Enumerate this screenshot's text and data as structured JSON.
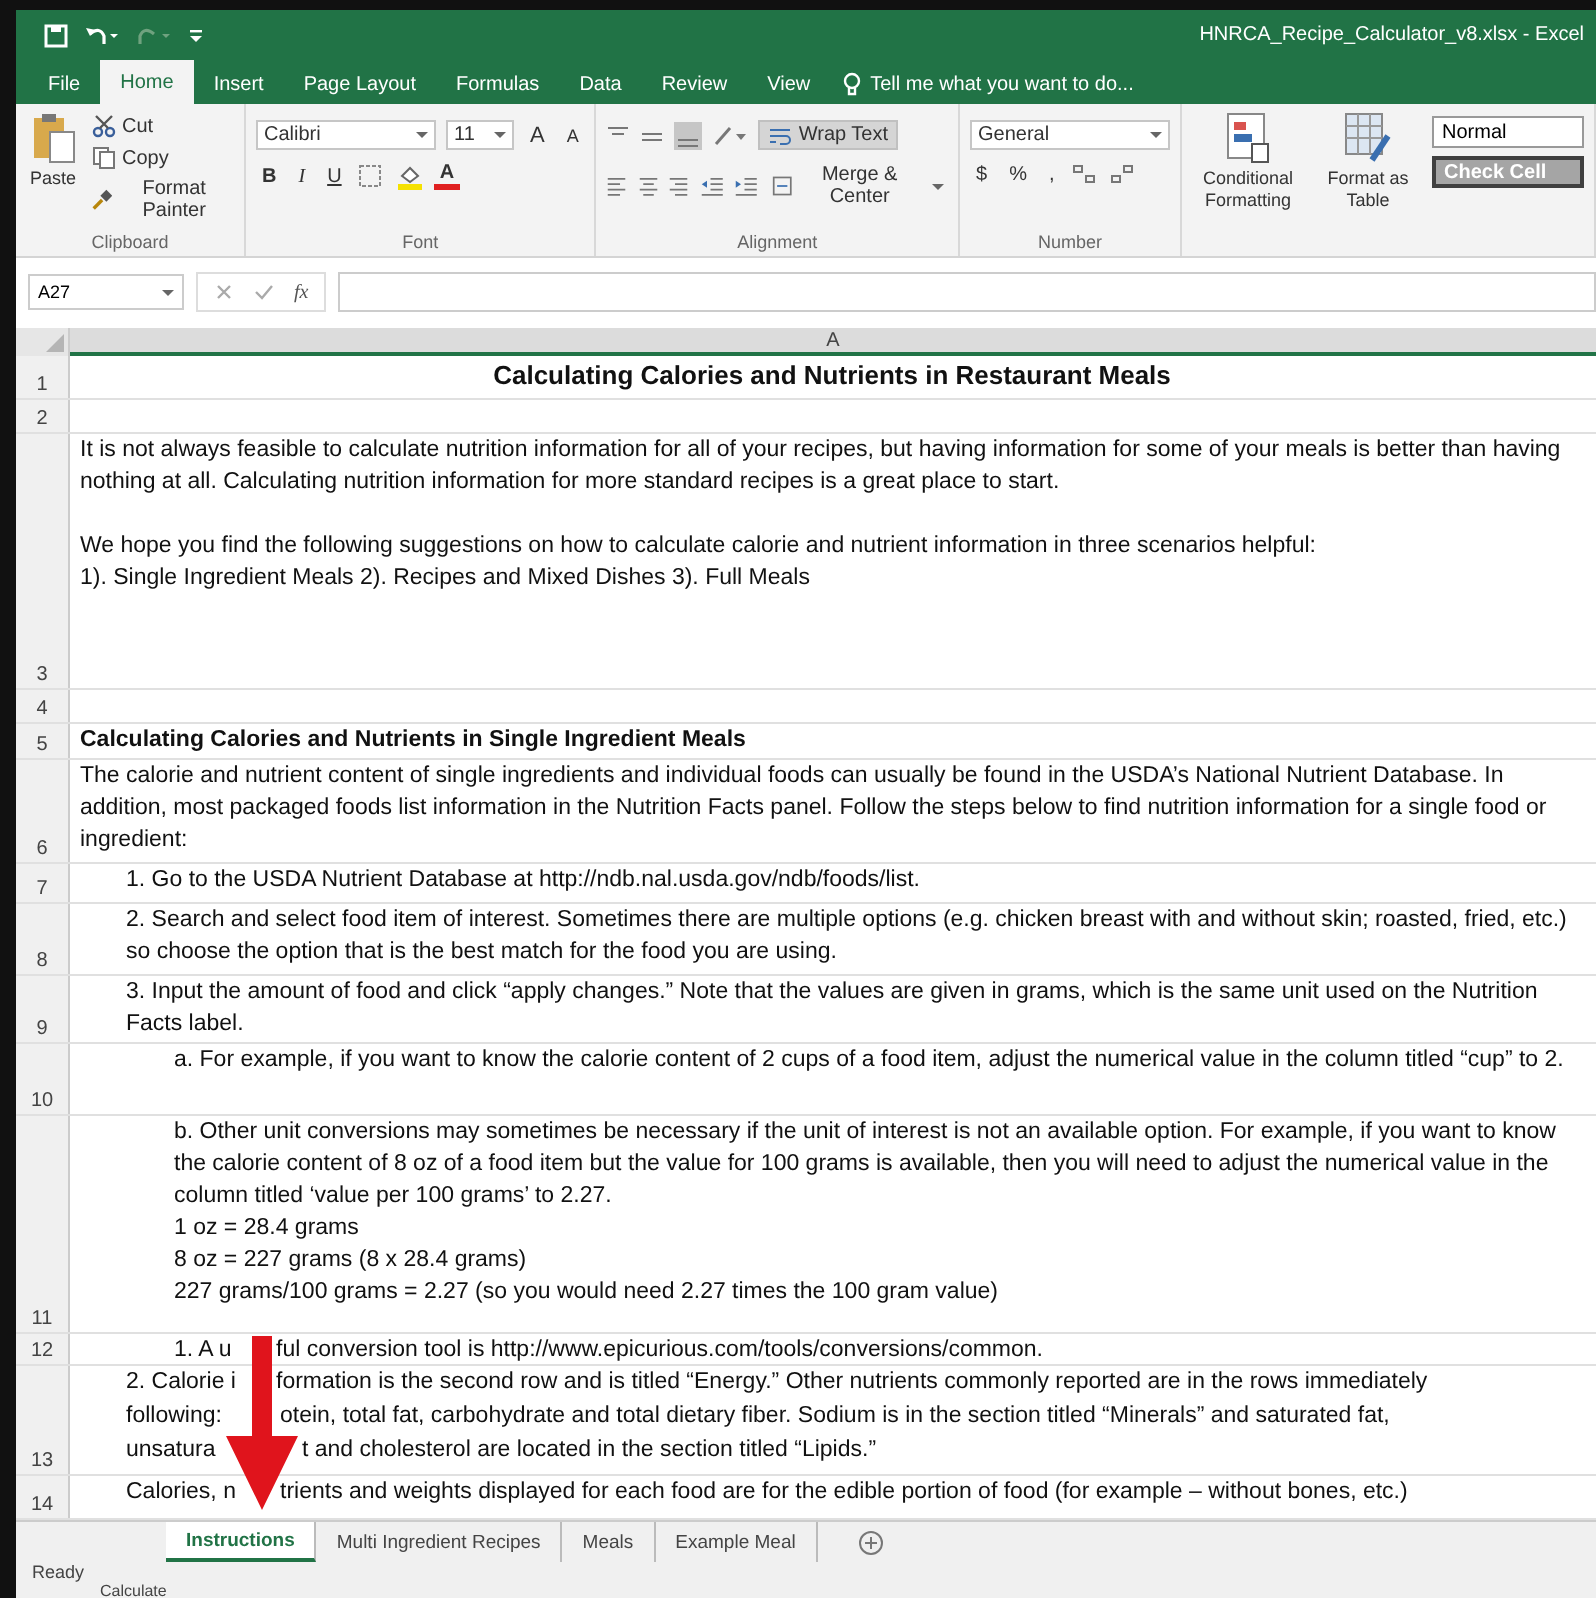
{
  "title_bar": {
    "title": "HNRCA_Recipe_Calculator_v8.xlsx - Excel"
  },
  "ribbon_tabs": [
    {
      "label": "File",
      "selected": false
    },
    {
      "label": "Home",
      "selected": true
    },
    {
      "label": "Insert",
      "selected": false
    },
    {
      "label": "Page Layout",
      "selected": false
    },
    {
      "label": "Formulas",
      "selected": false
    },
    {
      "label": "Data",
      "selected": false
    },
    {
      "label": "Review",
      "selected": false
    },
    {
      "label": "View",
      "selected": false
    }
  ],
  "tell_me": "Tell me what you want to do...",
  "clipboard": {
    "paste": "Paste",
    "cut": "Cut",
    "copy": "Copy",
    "format_painter": "Format Painter",
    "label": "Clipboard"
  },
  "font": {
    "name": "Calibri",
    "size": "11",
    "grow": "A",
    "shrink": "A",
    "bold": "B",
    "italic": "I",
    "underline": "U",
    "font_color_button": "A",
    "label": "Font"
  },
  "alignment": {
    "wrap_text": "Wrap Text",
    "merge_center": "Merge & Center",
    "label": "Alignment"
  },
  "number": {
    "format": "General",
    "currency": "$",
    "percent": "%",
    "comma": ",",
    "label": "Number"
  },
  "styles": {
    "conditional_formatting": "Conditional Formatting",
    "format_as_table": "Format as Table",
    "normal": "Normal",
    "check_cell": "Check Cell"
  },
  "formula_bar": {
    "name_box": "A27",
    "function_label": "fx"
  },
  "column_header": "A",
  "rows": [
    {
      "number": "1",
      "kind": "title",
      "text": "Calculating Calories and Nutrients in Restaurant Meals"
    },
    {
      "number": "2",
      "kind": "blank"
    },
    {
      "number": "3",
      "kind": "text",
      "text": "It is not always feasible to calculate nutrition information for all of your recipes, but having information for some of your meals is better than having nothing at all. Calculating nutrition information for more standard recipes is a great place to start.\n\nWe hope you find the following suggestions on how to calculate calorie and nutrient information in three scenarios helpful:\n1). Single Ingredient Meals  2). Recipes and Mixed Dishes  3). Full Meals"
    },
    {
      "number": "4",
      "kind": "blank"
    },
    {
      "number": "5",
      "kind": "heading",
      "text": "Calculating Calories and Nutrients in Single Ingredient Meals"
    },
    {
      "number": "6",
      "kind": "text",
      "text": "The calorie and nutrient content of single ingredients and individual foods can usually be found in the USDA’s National Nutrient Database. In addition, most packaged foods list information in the Nutrition Facts panel. Follow the steps below to find nutrition information for a single food or ingredient:"
    },
    {
      "number": "7",
      "kind": "step",
      "text": "1. Go to the USDA Nutrient Database at http://ndb.nal.usda.gov/ndb/foods/list."
    },
    {
      "number": "8",
      "kind": "step",
      "text": "2. Search and select food item of interest. Sometimes there are multiple options (e.g. chicken breast with and without skin; roasted, fried, etc.) so choose the option that is the best match for the food you are using."
    },
    {
      "number": "9",
      "kind": "step",
      "text": "3. Input the amount of food and click “apply changes.”  Note that the values are given in grams, which is the same unit used on the Nutrition Facts label."
    },
    {
      "number": "10",
      "kind": "substep",
      "text": "a. For example, if you want to know the calorie content of 2 cups of a food item, adjust the numerical value in the column titled “cup” to 2."
    },
    {
      "number": "11",
      "kind": "substep",
      "text": "b. Other unit conversions may sometimes be necessary if the unit of interest is not an available option. For example, if you want to know the calorie content of 8 oz of a food item but the value for 100 grams is available, then you will need to adjust the  numerical value in the column titled ‘value per 100 grams’ to 2.27.\n1 oz = 28.4 grams\n8 oz = 227 grams (8 x 28.4 grams)\n227 grams/100 grams = 2.27 (so you would need 2.27 times the 100 gram value)"
    },
    {
      "number": "12",
      "kind": "substep",
      "lines": [
        [
          "1.  A u",
          "ful conversion tool is http://www.epicurious.com/tools/conversions/common."
        ]
      ]
    },
    {
      "number": "13",
      "kind": "step",
      "lines": [
        [
          "2. Calorie i",
          "formation is the second row and is titled “Energy.” Other nutrients commonly reported are in the rows immediately"
        ],
        [
          "following:",
          "otein, total fat, carbohydrate and total dietary fiber. Sodium is in the section titled “Minerals” and saturated fat,"
        ],
        [
          "unsatura",
          "t and cholesterol are located in the section titled “Lipids.”"
        ]
      ]
    },
    {
      "number": "14",
      "kind": "step",
      "lines": [
        [
          "Calories, n",
          "trients and weights displayed for each food are for the edible portion of food (for example – without bones, etc.)"
        ]
      ]
    }
  ],
  "sheet_tabs": [
    {
      "label": "Instructions",
      "selected": true
    },
    {
      "label": "Multi Ingredient Recipes",
      "selected": false
    },
    {
      "label": "Meals",
      "selected": false
    },
    {
      "label": "Example Meal",
      "selected": false
    }
  ],
  "status_bar": {
    "state": "Ready",
    "message": "Calculate"
  }
}
